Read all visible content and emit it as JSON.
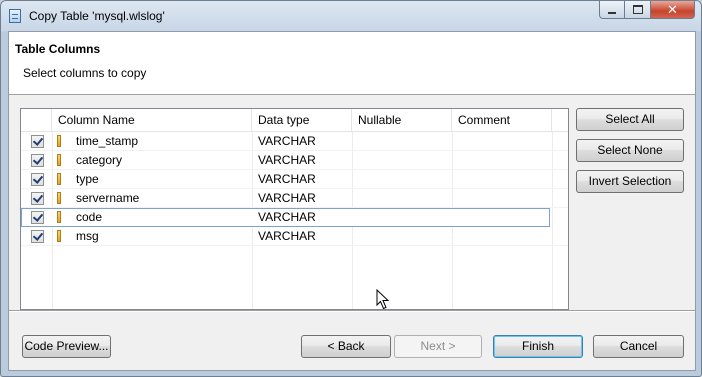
{
  "window": {
    "title": "Copy Table 'mysql.wlslog'",
    "buttons": {
      "minimize": "minimize",
      "maximize": "maximize",
      "close": "✕"
    }
  },
  "header": {
    "title": "Table Columns",
    "description": "Select columns to copy"
  },
  "table": {
    "columns": [
      "Column Name",
      "Data type",
      "Nullable",
      "Comment"
    ],
    "rows": [
      {
        "name": "time_stamp",
        "type": "VARCHAR",
        "nullable": "",
        "comment": "",
        "checked": true
      },
      {
        "name": "category",
        "type": "VARCHAR",
        "nullable": "",
        "comment": "",
        "checked": true
      },
      {
        "name": "type",
        "type": "VARCHAR",
        "nullable": "",
        "comment": "",
        "checked": true
      },
      {
        "name": "servername",
        "type": "VARCHAR",
        "nullable": "",
        "comment": "",
        "checked": true
      },
      {
        "name": "code",
        "type": "VARCHAR",
        "nullable": "",
        "comment": "",
        "checked": true
      },
      {
        "name": "msg",
        "type": "VARCHAR",
        "nullable": "",
        "comment": "",
        "checked": true
      }
    ]
  },
  "side_buttons": {
    "select_all": "Select All",
    "select_none": "Select None",
    "invert_selection": "Invert Selection"
  },
  "footer": {
    "code_preview": "Code Preview...",
    "back": "< Back",
    "next": "Next >",
    "finish": "Finish",
    "cancel": "Cancel"
  },
  "icons": {
    "window_icon": "table-window-icon",
    "column_icon": "column-key-icon",
    "checkbox": "checkbox-checked-icon",
    "cursor": "mouse-pointer-icon"
  },
  "colors": {
    "accent": "#3c7fb1",
    "selection_border": "#7da2ce",
    "column_icon": "#e2a623"
  }
}
